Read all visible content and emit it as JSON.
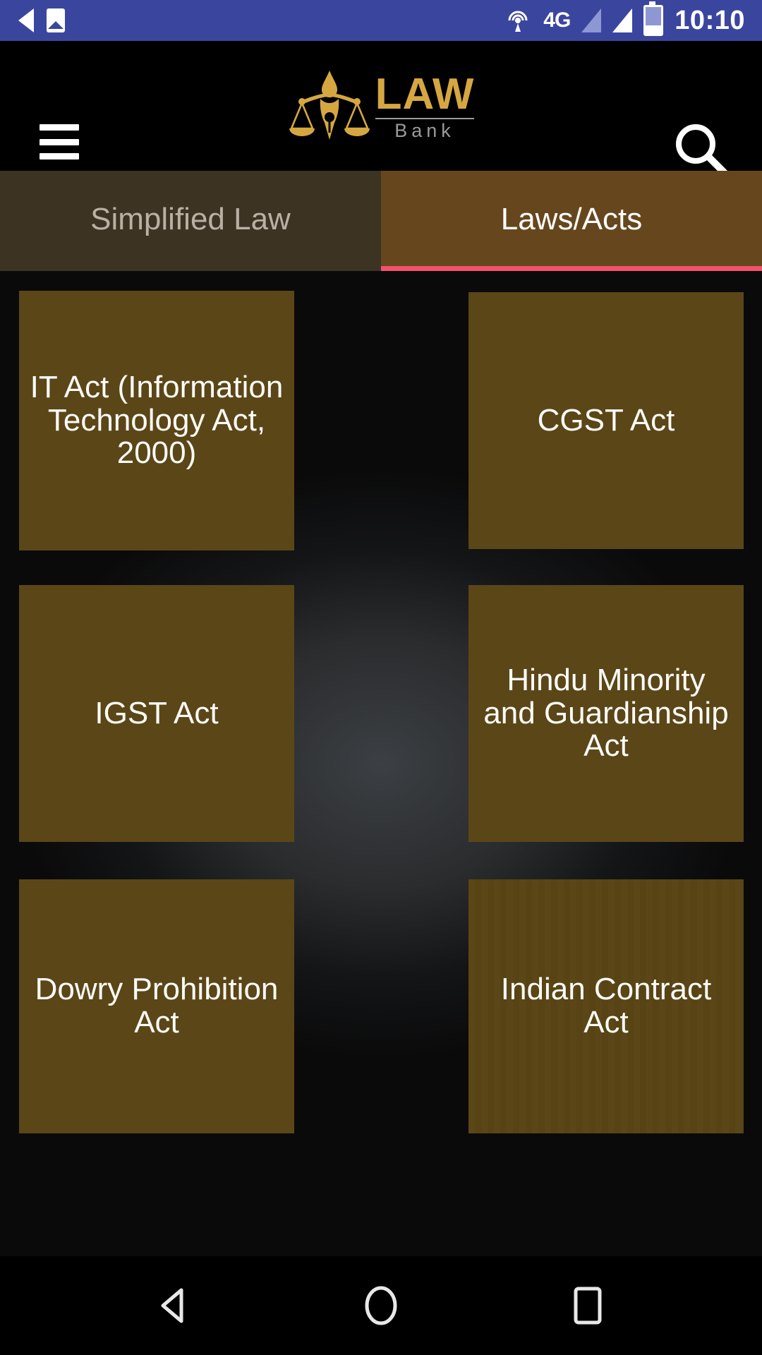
{
  "status_bar": {
    "back_icon": "back-triangle-icon",
    "image_icon": "image-icon",
    "hotspot_icon": "hotspot-icon",
    "network_label": "4G",
    "signal_icon_1": "signal-bars-icon",
    "signal_icon_2": "signal-bars-icon",
    "battery_icon": "battery-icon",
    "time": "10:10",
    "background_color": "#3a469e"
  },
  "app_bar": {
    "menu_icon": "hamburger-menu-icon",
    "logo": {
      "mark_icon": "scales-of-justice-pen-icon",
      "word": "LAW",
      "subword": "Bank",
      "gold_color": "#d6a741",
      "sub_color": "#9c9a98"
    },
    "search_icon": "search-icon",
    "background_color": "#000000"
  },
  "tabs": {
    "items": [
      {
        "label": "Simplified Law",
        "active": false
      },
      {
        "label": "Laws/Acts",
        "active": true
      }
    ],
    "inactive_background": "#3c3323",
    "active_background": "#66471d",
    "indicator_color": "#f4516c"
  },
  "grid": {
    "card_color": "#5b4618",
    "card_text_color": "#fdfcf7",
    "rows": [
      [
        {
          "label": "IT Act (Information Technology Act, 2000)"
        },
        {
          "label": "CGST Act"
        }
      ],
      [
        {
          "label": "IGST Act"
        },
        {
          "label": "Hindu Minority and Guardianship Act"
        }
      ],
      [
        {
          "label": "Dowry Prohibition Act"
        },
        {
          "label": "Indian Contract Act"
        }
      ]
    ]
  },
  "nav_bar": {
    "back_icon": "nav-back-icon",
    "home_icon": "nav-home-icon",
    "recents_icon": "nav-recents-icon",
    "background_color": "#000000"
  }
}
